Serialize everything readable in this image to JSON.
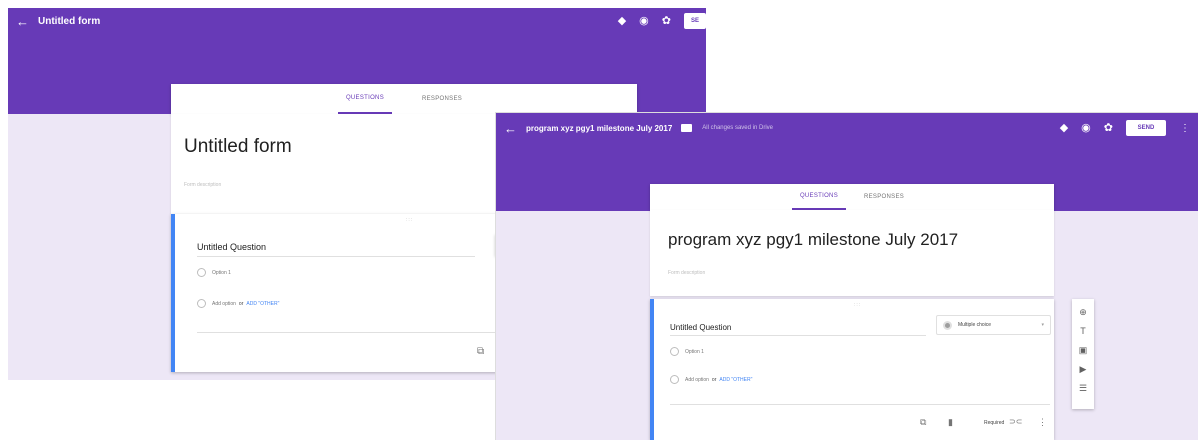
{
  "screen1": {
    "title": "Untitled form",
    "icons": [
      "palette-icon",
      "eye-icon",
      "gear-icon"
    ],
    "send_label": "SE",
    "tabs": {
      "questions": "QUESTIONS",
      "responses": "RESPONSES"
    },
    "form_title": "Untitled form",
    "form_description": "Form description",
    "question": {
      "title": "Untitled Question",
      "option1": "Option 1",
      "add_option": "Add option",
      "or": "or",
      "add_other": "ADD \"OTHER\""
    }
  },
  "screen2": {
    "title": "program xyz pgy1 milestone July 2017",
    "saved_status": "All changes saved in Drive",
    "send_label": "SEND",
    "tabs": {
      "questions": "QUESTIONS",
      "responses": "RESPONSES"
    },
    "form_title": "program xyz pgy1 milestone July 2017",
    "form_description": "Form description",
    "question": {
      "title": "Untitled Question",
      "type": "Multiple choice",
      "option1": "Option 1",
      "add_option": "Add option",
      "or": "or",
      "add_other": "ADD \"OTHER\"",
      "required_label": "Required"
    },
    "toolbox": [
      "add-question-icon",
      "add-title-icon",
      "add-image-icon",
      "add-video-icon",
      "add-section-icon"
    ]
  },
  "colors": {
    "accent": "#673ab7",
    "background": "#ede7f6",
    "link": "#4285f4"
  }
}
